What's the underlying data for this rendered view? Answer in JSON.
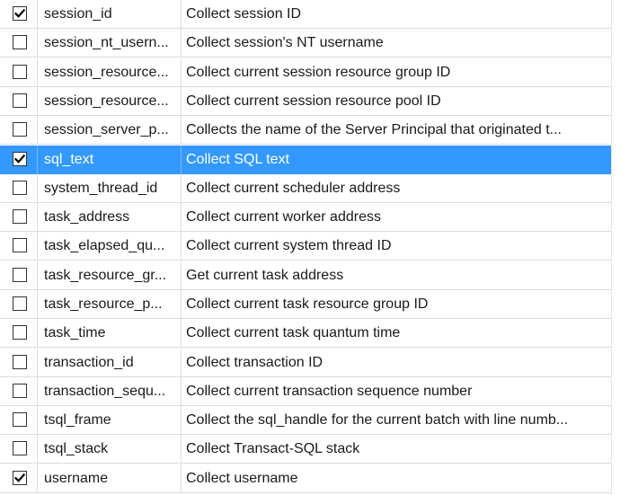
{
  "colors": {
    "selection": "#3399ff",
    "gridline": "#dcdcdc"
  },
  "rows": [
    {
      "name": "session_id",
      "description": "Collect session ID",
      "checked": true,
      "selected": false
    },
    {
      "name": "session_nt_usern...",
      "description": "Collect session's NT username",
      "checked": false,
      "selected": false
    },
    {
      "name": "session_resource...",
      "description": "Collect current session resource group ID",
      "checked": false,
      "selected": false
    },
    {
      "name": "session_resource...",
      "description": "Collect current session resource pool ID",
      "checked": false,
      "selected": false
    },
    {
      "name": "session_server_p...",
      "description": "Collects the name of the Server Principal that originated t...",
      "checked": false,
      "selected": false
    },
    {
      "name": "sql_text",
      "description": "Collect SQL text",
      "checked": true,
      "selected": true
    },
    {
      "name": "system_thread_id",
      "description": "Collect current scheduler address",
      "checked": false,
      "selected": false
    },
    {
      "name": "task_address",
      "description": "Collect current worker address",
      "checked": false,
      "selected": false
    },
    {
      "name": "task_elapsed_qu...",
      "description": "Collect current system thread ID",
      "checked": false,
      "selected": false
    },
    {
      "name": "task_resource_gr...",
      "description": "Get current task address",
      "checked": false,
      "selected": false
    },
    {
      "name": "task_resource_p...",
      "description": "Collect current task resource group ID",
      "checked": false,
      "selected": false
    },
    {
      "name": "task_time",
      "description": "Collect current task quantum time",
      "checked": false,
      "selected": false
    },
    {
      "name": "transaction_id",
      "description": "Collect transaction ID",
      "checked": false,
      "selected": false
    },
    {
      "name": "transaction_sequ...",
      "description": "Collect current transaction sequence number",
      "checked": false,
      "selected": false
    },
    {
      "name": "tsql_frame",
      "description": "Collect the sql_handle for the current batch with line numb...",
      "checked": false,
      "selected": false
    },
    {
      "name": "tsql_stack",
      "description": "Collect Transact-SQL stack",
      "checked": false,
      "selected": false
    },
    {
      "name": "username",
      "description": "Collect username",
      "checked": true,
      "selected": false
    }
  ]
}
